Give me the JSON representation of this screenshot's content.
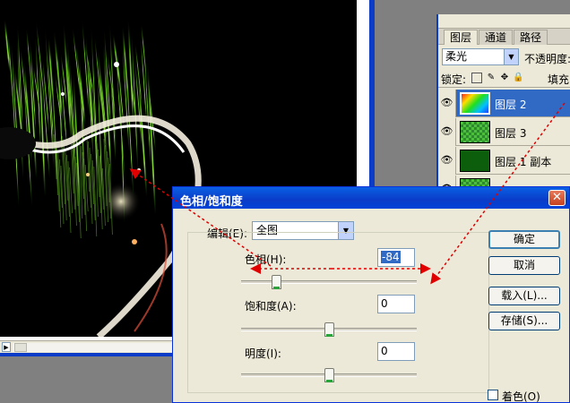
{
  "layers_panel": {
    "tabs": [
      "图层",
      "通道",
      "路径"
    ],
    "blend_mode": "柔光",
    "opacity_label": "不透明度:",
    "lock_label": "锁定:",
    "fill_label": "填充:",
    "layers": [
      {
        "name": "图层 2",
        "selected": true
      },
      {
        "name": "图层 3",
        "selected": false
      },
      {
        "name": "图层 1 副本",
        "selected": false
      },
      {
        "name": "",
        "selected": false
      }
    ],
    "icons": {
      "visibility": "eye-icon",
      "arrow": "chevron-down-icon"
    }
  },
  "dialog": {
    "title": "色相/饱和度",
    "close_label": "✕",
    "edit_label": "编辑(E):",
    "edit_value": "全图",
    "hue_label": "色相(H):",
    "hue_value": "-84",
    "hue_position": 0.2,
    "saturation_label": "饱和度(A):",
    "saturation_value": "0",
    "saturation_position": 0.5,
    "lightness_label": "明度(I):",
    "lightness_value": "0",
    "lightness_position": 0.5,
    "ok_label": "确定",
    "cancel_label": "取消",
    "load_label": "载入(L)...",
    "save_label": "存储(S)...",
    "colorize_label": "着色(O)"
  },
  "colors": {
    "title_blue": "#0a3cc8",
    "selection_blue": "#316ac5",
    "annotation_red": "#e00000"
  }
}
